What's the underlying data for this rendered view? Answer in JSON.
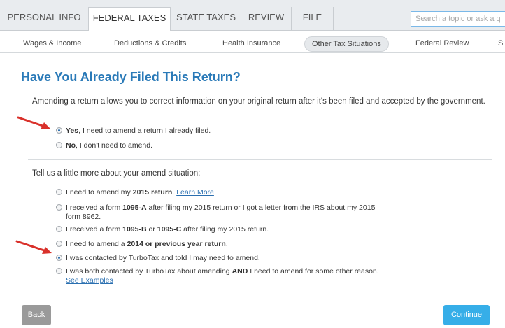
{
  "topnav": {
    "tabs": [
      {
        "label": "PERSONAL INFO"
      },
      {
        "label": "FEDERAL TAXES"
      },
      {
        "label": "STATE TAXES"
      },
      {
        "label": "REVIEW"
      },
      {
        "label": "FILE"
      }
    ],
    "active_tab": "FEDERAL TAXES",
    "search_placeholder": "Search a topic or ask a q"
  },
  "subnav": {
    "items": [
      {
        "label": "Wages & Income"
      },
      {
        "label": "Deductions & Credits"
      },
      {
        "label": "Health Insurance"
      },
      {
        "label": "Other Tax Situations"
      },
      {
        "label": "Federal Review"
      },
      {
        "label": "S"
      }
    ],
    "active_item": "Other Tax Situations"
  },
  "page": {
    "title": "Have You Already Filed This Return?",
    "intro": "Amending a return allows you to correct information on your original return after it's been filed and accepted by the government.",
    "filed_options": [
      {
        "bold": "Yes",
        "text": ", I need to amend a return I already filed.",
        "selected": true
      },
      {
        "bold": "No",
        "text": ", I don't need to amend.",
        "selected": false
      }
    ],
    "situation_heading": "Tell us a little more about your amend situation:",
    "situation_options": [
      {
        "pre": "I need to amend my ",
        "bold": "2015 return",
        "post": ". ",
        "link": "Learn More",
        "selected": false
      },
      {
        "pre": "I received a form ",
        "bold": "1095-A",
        "post": " after filing my 2015 return or I got a letter from the IRS about my 2015",
        "line2": "form 8962.",
        "selected": false
      },
      {
        "pre": "I received a form ",
        "bold": "1095-B",
        "mid": " or ",
        "bold2": "1095-C",
        "post": " after filing my 2015 return.",
        "selected": false
      },
      {
        "pre": "I need to amend a ",
        "bold": "2014 or previous year return",
        "post": ".",
        "selected": false
      },
      {
        "pre": "I was contacted by TurboTax and told I may need to amend.",
        "selected": true
      },
      {
        "pre": "I was both contacted by TurboTax about amending ",
        "bold": "AND",
        "post": " I need to amend for some other reason.",
        "link2": "See Examples",
        "selected": false
      }
    ]
  },
  "footer": {
    "back_label": "Back",
    "continue_label": "Continue"
  },
  "colors": {
    "title": "#2a7ab8",
    "continue_button": "#36aee8",
    "back_button": "#9a9a9a",
    "arrow": "#d9312b"
  }
}
